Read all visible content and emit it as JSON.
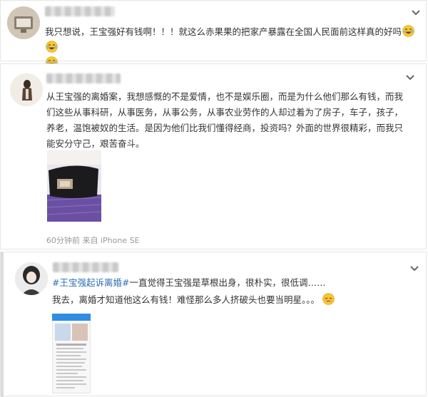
{
  "post1": {
    "text": "我只想说，王宝强好有钱啊！！！就这么赤果果的把家产暴露在全国人民面前这样真的好吗"
  },
  "post2": {
    "text": "从王宝强的离婚案，我想感慨的不是爱情，也不是娱乐圈，而是为什么他们那么有钱，而我们这些从事科研，从事医务，从事公务，从事农业劳作的人却过着为了房子，车子，孩子，养老，温饱被奴的生活。是因为他们比我们懂得经商，投资吗？外面的世界很精彩，而我只能安分守己，艰苦奋斗。",
    "meta": "60分钟前 来自 iPhone SE"
  },
  "post3": {
    "topic": "#王宝强起诉离婚#",
    "quote": "一直觉得王宝强是草根出身，很朴实，很低调……",
    "text": "我去，离婚才知道他这么有钱！难怪那么多人挤破头也要当明星。。。"
  },
  "icons": {
    "chevron": "chevron-down-icon",
    "laugh": "laugh-cry-emoji-icon",
    "sleepy": "sleepy-emoji-icon"
  },
  "colors": {
    "topic_link": "#2e6fb5",
    "text": "#333333",
    "meta": "#999999",
    "emoji": "#f7c531"
  }
}
